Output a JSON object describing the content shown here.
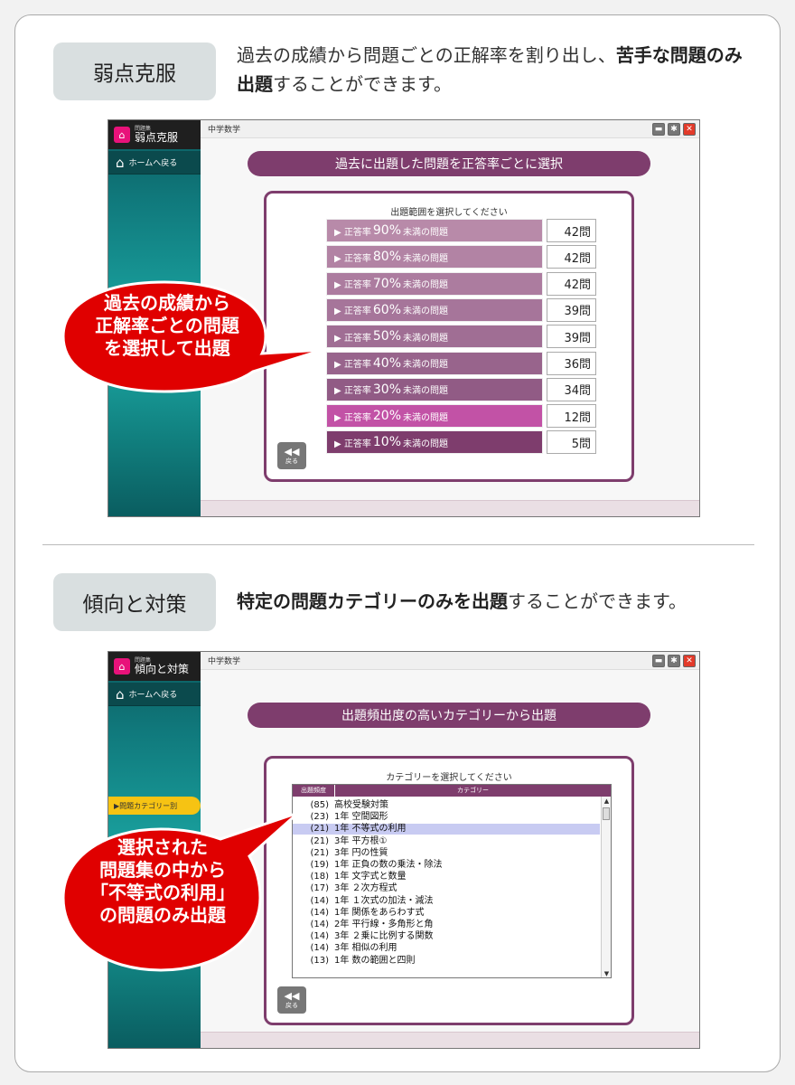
{
  "section1": {
    "badge": "弱点克服",
    "desc_normal1": "過去の成績から問題ごとの正解率を割り出し、",
    "desc_bold": "苦手な問題のみ出題",
    "desc_normal2": "することができます。",
    "callout_lines": [
      "過去の成績から",
      "正解率ごとの問題",
      "を選択して出題"
    ]
  },
  "section2": {
    "badge": "傾向と対策",
    "desc_bold": "特定の問題カテゴリーのみを出題",
    "desc_normal": "することができます。",
    "callout_lines": [
      "選択された",
      "問題集の中から",
      "「不等式の利用」",
      "の問題のみ出題"
    ]
  },
  "window1": {
    "app_small": "問題集",
    "app_name": "弱点克服",
    "home": "ホームへ戻る",
    "subject": "中学数学",
    "title": "過去に出題した問題を正答率ごとに選択",
    "panel_title": "出題範囲を選択してください",
    "back": "戻る",
    "row_prefix": "▶ 正答率",
    "row_suffix": "未満の問題",
    "rows": [
      {
        "pct": "90%",
        "count": "42問",
        "color": "#b88aa9"
      },
      {
        "pct": "80%",
        "count": "42問",
        "color": "#b283a4"
      },
      {
        "pct": "70%",
        "count": "42問",
        "color": "#ac7c9f"
      },
      {
        "pct": "60%",
        "count": "39問",
        "color": "#a6759a"
      },
      {
        "pct": "50%",
        "count": "39問",
        "color": "#a06e94"
      },
      {
        "pct": "40%",
        "count": "36問",
        "color": "#98648c"
      },
      {
        "pct": "30%",
        "count": "34問",
        "color": "#915b85"
      },
      {
        "pct": "20%",
        "count": "12問",
        "color": "#c252a6"
      },
      {
        "pct": "10%",
        "count": "5問",
        "color": "#7e3d6d"
      }
    ]
  },
  "window2": {
    "app_small": "問題集",
    "app_name": "傾向と対策",
    "home": "ホームへ戻る",
    "subject": "中学数学",
    "side_tab": "▶問題カテゴリー別",
    "title": "出題頻出度の高いカテゴリーから出題",
    "panel_title": "カテゴリーを選択してください",
    "col_freq": "出題頻度",
    "col_cat": "カテゴリー",
    "back": "戻る",
    "items": [
      {
        "freq": "(85)",
        "name": "高校受験対策"
      },
      {
        "freq": "(23)",
        "name": "1年 空間図形"
      },
      {
        "freq": "(21)",
        "name": "1年 不等式の利用"
      },
      {
        "freq": "(21)",
        "name": "3年 平方根①"
      },
      {
        "freq": "(21)",
        "name": "3年 円の性質"
      },
      {
        "freq": "(19)",
        "name": "1年 正負の数の乗法・除法"
      },
      {
        "freq": "(18)",
        "name": "1年 文字式と数量"
      },
      {
        "freq": "(17)",
        "name": "3年 ２次方程式"
      },
      {
        "freq": "(14)",
        "name": "1年 １次式の加法・減法"
      },
      {
        "freq": "(14)",
        "name": "1年 関係をあらわす式"
      },
      {
        "freq": "(14)",
        "name": "2年 平行線・多角形と角"
      },
      {
        "freq": "(14)",
        "name": "3年 ２乗に比例する関数"
      },
      {
        "freq": "(14)",
        "name": "3年 相似の利用"
      },
      {
        "freq": "(13)",
        "name": "1年 数の範囲と四則"
      }
    ],
    "selected_index": 2
  },
  "colors": {
    "accent": "#7e3d6d",
    "callout_red": "#e00000",
    "pink_icon": "#e8127a",
    "selected_row": "#c8cbf2"
  }
}
